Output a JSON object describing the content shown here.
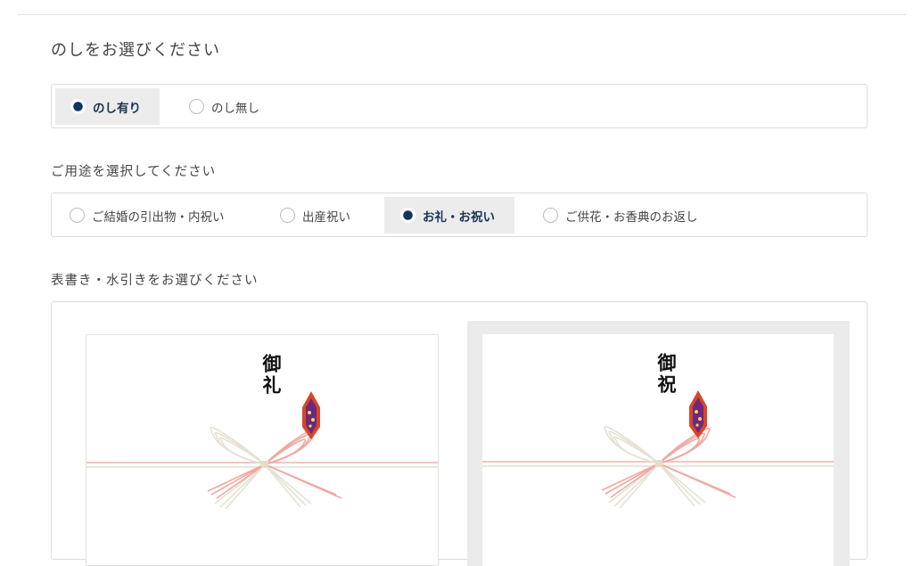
{
  "noshi": {
    "heading": "のしをお選びください",
    "options": [
      {
        "label": "のし有り",
        "selected": true
      },
      {
        "label": "のし無し",
        "selected": false
      }
    ]
  },
  "purpose": {
    "heading": "ご用途を選択してください",
    "options": [
      {
        "label": "ご結婚の引出物・内祝い",
        "selected": false
      },
      {
        "label": "出産祝い",
        "selected": false
      },
      {
        "label": "お礼・お祝い",
        "selected": true
      },
      {
        "label": "ご供花・お香典のお返し",
        "selected": false
      }
    ]
  },
  "omotegaki": {
    "heading": "表書き・水引きをお選びください",
    "cards": [
      {
        "text": "御礼",
        "selected": false
      },
      {
        "text": "御祝",
        "selected": true
      }
    ]
  },
  "colors": {
    "selected_radio": "#0e3460",
    "selected_text": "#1a3356",
    "selected_bg": "#ececec",
    "mizuhiki_red": "#ef9b95",
    "mizuhiki_white": "#e3dfd0",
    "noshi_red": "#d9452a",
    "noshi_purple": "#6a2a7c"
  }
}
